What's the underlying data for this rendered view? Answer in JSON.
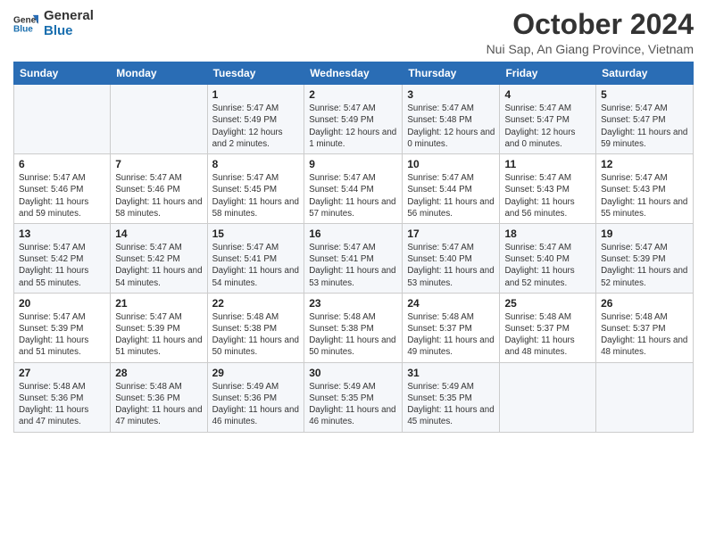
{
  "header": {
    "logo_line1": "General",
    "logo_line2": "Blue",
    "month_title": "October 2024",
    "location": "Nui Sap, An Giang Province, Vietnam"
  },
  "weekdays": [
    "Sunday",
    "Monday",
    "Tuesday",
    "Wednesday",
    "Thursday",
    "Friday",
    "Saturday"
  ],
  "weeks": [
    [
      {
        "day": "",
        "info": ""
      },
      {
        "day": "",
        "info": ""
      },
      {
        "day": "1",
        "info": "Sunrise: 5:47 AM\nSunset: 5:49 PM\nDaylight: 12 hours and 2 minutes."
      },
      {
        "day": "2",
        "info": "Sunrise: 5:47 AM\nSunset: 5:49 PM\nDaylight: 12 hours and 1 minute."
      },
      {
        "day": "3",
        "info": "Sunrise: 5:47 AM\nSunset: 5:48 PM\nDaylight: 12 hours and 0 minutes."
      },
      {
        "day": "4",
        "info": "Sunrise: 5:47 AM\nSunset: 5:47 PM\nDaylight: 12 hours and 0 minutes."
      },
      {
        "day": "5",
        "info": "Sunrise: 5:47 AM\nSunset: 5:47 PM\nDaylight: 11 hours and 59 minutes."
      }
    ],
    [
      {
        "day": "6",
        "info": "Sunrise: 5:47 AM\nSunset: 5:46 PM\nDaylight: 11 hours and 59 minutes."
      },
      {
        "day": "7",
        "info": "Sunrise: 5:47 AM\nSunset: 5:46 PM\nDaylight: 11 hours and 58 minutes."
      },
      {
        "day": "8",
        "info": "Sunrise: 5:47 AM\nSunset: 5:45 PM\nDaylight: 11 hours and 58 minutes."
      },
      {
        "day": "9",
        "info": "Sunrise: 5:47 AM\nSunset: 5:44 PM\nDaylight: 11 hours and 57 minutes."
      },
      {
        "day": "10",
        "info": "Sunrise: 5:47 AM\nSunset: 5:44 PM\nDaylight: 11 hours and 56 minutes."
      },
      {
        "day": "11",
        "info": "Sunrise: 5:47 AM\nSunset: 5:43 PM\nDaylight: 11 hours and 56 minutes."
      },
      {
        "day": "12",
        "info": "Sunrise: 5:47 AM\nSunset: 5:43 PM\nDaylight: 11 hours and 55 minutes."
      }
    ],
    [
      {
        "day": "13",
        "info": "Sunrise: 5:47 AM\nSunset: 5:42 PM\nDaylight: 11 hours and 55 minutes."
      },
      {
        "day": "14",
        "info": "Sunrise: 5:47 AM\nSunset: 5:42 PM\nDaylight: 11 hours and 54 minutes."
      },
      {
        "day": "15",
        "info": "Sunrise: 5:47 AM\nSunset: 5:41 PM\nDaylight: 11 hours and 54 minutes."
      },
      {
        "day": "16",
        "info": "Sunrise: 5:47 AM\nSunset: 5:41 PM\nDaylight: 11 hours and 53 minutes."
      },
      {
        "day": "17",
        "info": "Sunrise: 5:47 AM\nSunset: 5:40 PM\nDaylight: 11 hours and 53 minutes."
      },
      {
        "day": "18",
        "info": "Sunrise: 5:47 AM\nSunset: 5:40 PM\nDaylight: 11 hours and 52 minutes."
      },
      {
        "day": "19",
        "info": "Sunrise: 5:47 AM\nSunset: 5:39 PM\nDaylight: 11 hours and 52 minutes."
      }
    ],
    [
      {
        "day": "20",
        "info": "Sunrise: 5:47 AM\nSunset: 5:39 PM\nDaylight: 11 hours and 51 minutes."
      },
      {
        "day": "21",
        "info": "Sunrise: 5:47 AM\nSunset: 5:39 PM\nDaylight: 11 hours and 51 minutes."
      },
      {
        "day": "22",
        "info": "Sunrise: 5:48 AM\nSunset: 5:38 PM\nDaylight: 11 hours and 50 minutes."
      },
      {
        "day": "23",
        "info": "Sunrise: 5:48 AM\nSunset: 5:38 PM\nDaylight: 11 hours and 50 minutes."
      },
      {
        "day": "24",
        "info": "Sunrise: 5:48 AM\nSunset: 5:37 PM\nDaylight: 11 hours and 49 minutes."
      },
      {
        "day": "25",
        "info": "Sunrise: 5:48 AM\nSunset: 5:37 PM\nDaylight: 11 hours and 48 minutes."
      },
      {
        "day": "26",
        "info": "Sunrise: 5:48 AM\nSunset: 5:37 PM\nDaylight: 11 hours and 48 minutes."
      }
    ],
    [
      {
        "day": "27",
        "info": "Sunrise: 5:48 AM\nSunset: 5:36 PM\nDaylight: 11 hours and 47 minutes."
      },
      {
        "day": "28",
        "info": "Sunrise: 5:48 AM\nSunset: 5:36 PM\nDaylight: 11 hours and 47 minutes."
      },
      {
        "day": "29",
        "info": "Sunrise: 5:49 AM\nSunset: 5:36 PM\nDaylight: 11 hours and 46 minutes."
      },
      {
        "day": "30",
        "info": "Sunrise: 5:49 AM\nSunset: 5:35 PM\nDaylight: 11 hours and 46 minutes."
      },
      {
        "day": "31",
        "info": "Sunrise: 5:49 AM\nSunset: 5:35 PM\nDaylight: 11 hours and 45 minutes."
      },
      {
        "day": "",
        "info": ""
      },
      {
        "day": "",
        "info": ""
      }
    ]
  ]
}
